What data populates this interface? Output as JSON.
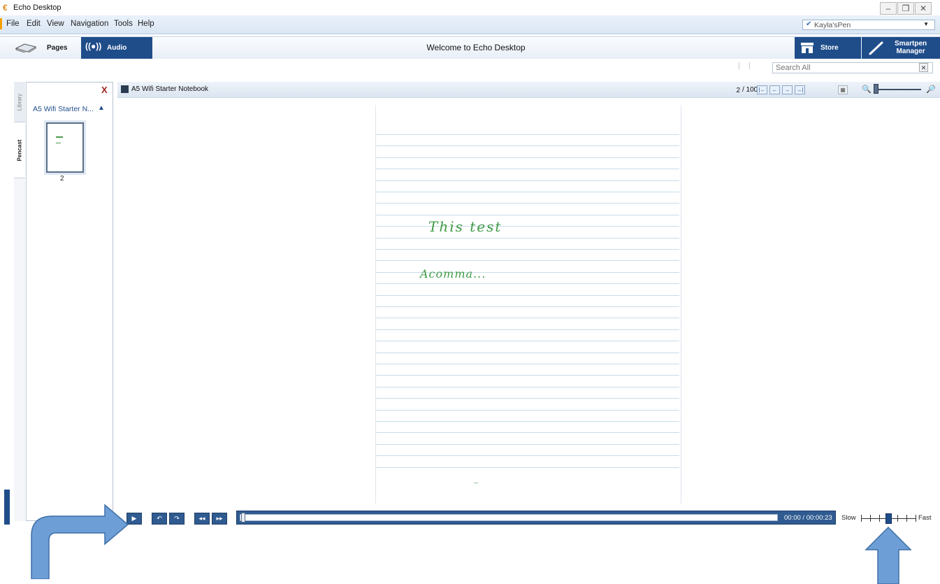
{
  "window": {
    "title": "Echo Desktop",
    "controls": [
      "minimize",
      "restore",
      "close"
    ]
  },
  "menubar": {
    "items": [
      "File",
      "Edit",
      "View",
      "Navigation",
      "Tools",
      "Help"
    ],
    "pen_selector": {
      "value": "Kayla'sPen"
    }
  },
  "toolbar": {
    "tabs": [
      {
        "label": "Pages",
        "icon": "notebook-icon",
        "active": false
      },
      {
        "label": "Audio",
        "icon": "audio-waves-icon",
        "active": true
      }
    ],
    "center_title": "Welcome to Echo Desktop",
    "store_label": "Store",
    "smartpen_label_1": "Smartpen",
    "smartpen_label_2": "Manager"
  },
  "search": {
    "placeholder": "Search All"
  },
  "sidebar": {
    "vertical_tabs": [
      "Library",
      "Pencast"
    ],
    "close_label": "X",
    "notebook_title": "A5 Wifi Starter N...",
    "thumbnail_page": "2"
  },
  "notebook": {
    "title": "A5 Wifi Starter Notebook",
    "current_page": "2",
    "total_pages": "/ 100",
    "nav_buttons": [
      "first-page",
      "previous-page",
      "next-page",
      "last-page"
    ]
  },
  "page_content": {
    "handwriting_line_1": "This test",
    "handwriting_line_2": "Acomma..."
  },
  "playback": {
    "buttons": [
      "play",
      "rewind",
      "forward",
      "skip-back",
      "skip-forward"
    ],
    "time": "00:00 / 00:00:23",
    "slow_label": "Slow",
    "fast_label": "Fast",
    "progress_fraction": 0.0,
    "speed_level": 0.5
  },
  "colors": {
    "accent_blue": "#1f4d8a",
    "handwriting_green": "#3e9a45",
    "arrow_blue": "#6d9fd6",
    "close_red": "#a02020"
  }
}
